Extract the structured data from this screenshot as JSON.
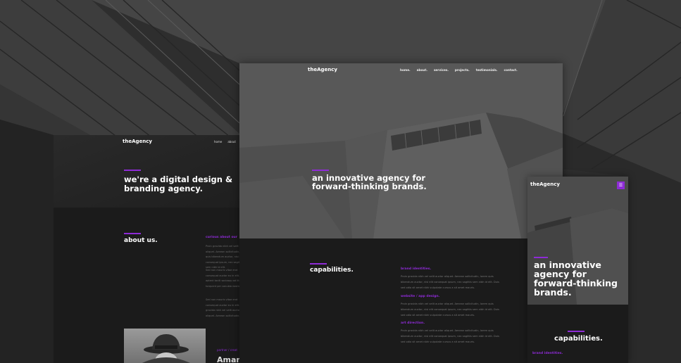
{
  "theme": {
    "accent": "#8e2bd6",
    "dark": "#1b1b1b",
    "hero_gray": "#585858"
  },
  "desktop_left": {
    "brand": "theAgency",
    "nav": [
      "home",
      "about"
    ],
    "hero_title": "we're a digital design & branding agency.",
    "about_title": "about us.",
    "about_sub": "curious about our",
    "para1": "Proin gravida nibh vel velit auctor aliquet. Aenean sollicitudin, lorem quis bibendum auctor, nisi elit consequat ipsum, nec sagittis sem nibh id elit.",
    "para2": "Sed non mauris vitae erat consequat auctor eu in elit. Class aptent taciti sociosqu ad litora torquent per conubia nostra.",
    "para3": "Sed non mauris vitae erat consequat auctor eu in elit. Proin gravida nibh vel velit auctor aliquet. Aenean sollicitudin.",
    "partner_label": "partner / creat",
    "person_name": "Amand"
  },
  "desktop_center": {
    "brand": "theAgency",
    "nav": [
      "home.",
      "about.",
      "services.",
      "projects.",
      "testimonials.",
      "contact."
    ],
    "hero_title": "an innovative agency for forward-thinking brands.",
    "cap_title": "capabilities.",
    "services": [
      {
        "title": "brand identities.",
        "text": "Proin gravida nibh vel velit auctor aliquet. Aenean sollicitudin, lorem quis bibendum auctor, nisi elit consequat ipsum, nec sagittis sem nibh id elit. Duis sed odio sit amet nibh vulputate cursus a sit amet mauris."
      },
      {
        "title": "website / app design.",
        "text": "Proin gravida nibh vel velit auctor aliquet. Aenean sollicitudin, lorem quis bibendum auctor, nisi elit consequat ipsum, nec sagittis sem nibh id elit. Duis sed odio sit amet nibh vulputate cursus a sit amet mauris."
      },
      {
        "title": "art direction.",
        "text": "Proin gravida nibh vel velit auctor aliquet. Aenean sollicitudin, lorem quis bibendum auctor, nisi elit consequat ipsum, nec sagittis sem nibh id elit. Duis sed odio sit amet nibh vulputate cursus a sit amet mauris."
      }
    ]
  },
  "mobile_right": {
    "brand": "theAgency",
    "menu_icon": "☰",
    "hero_title": "an innovative agency for forward-thinking brands.",
    "cap_title": "capabilities.",
    "service_first": "brand identities."
  }
}
